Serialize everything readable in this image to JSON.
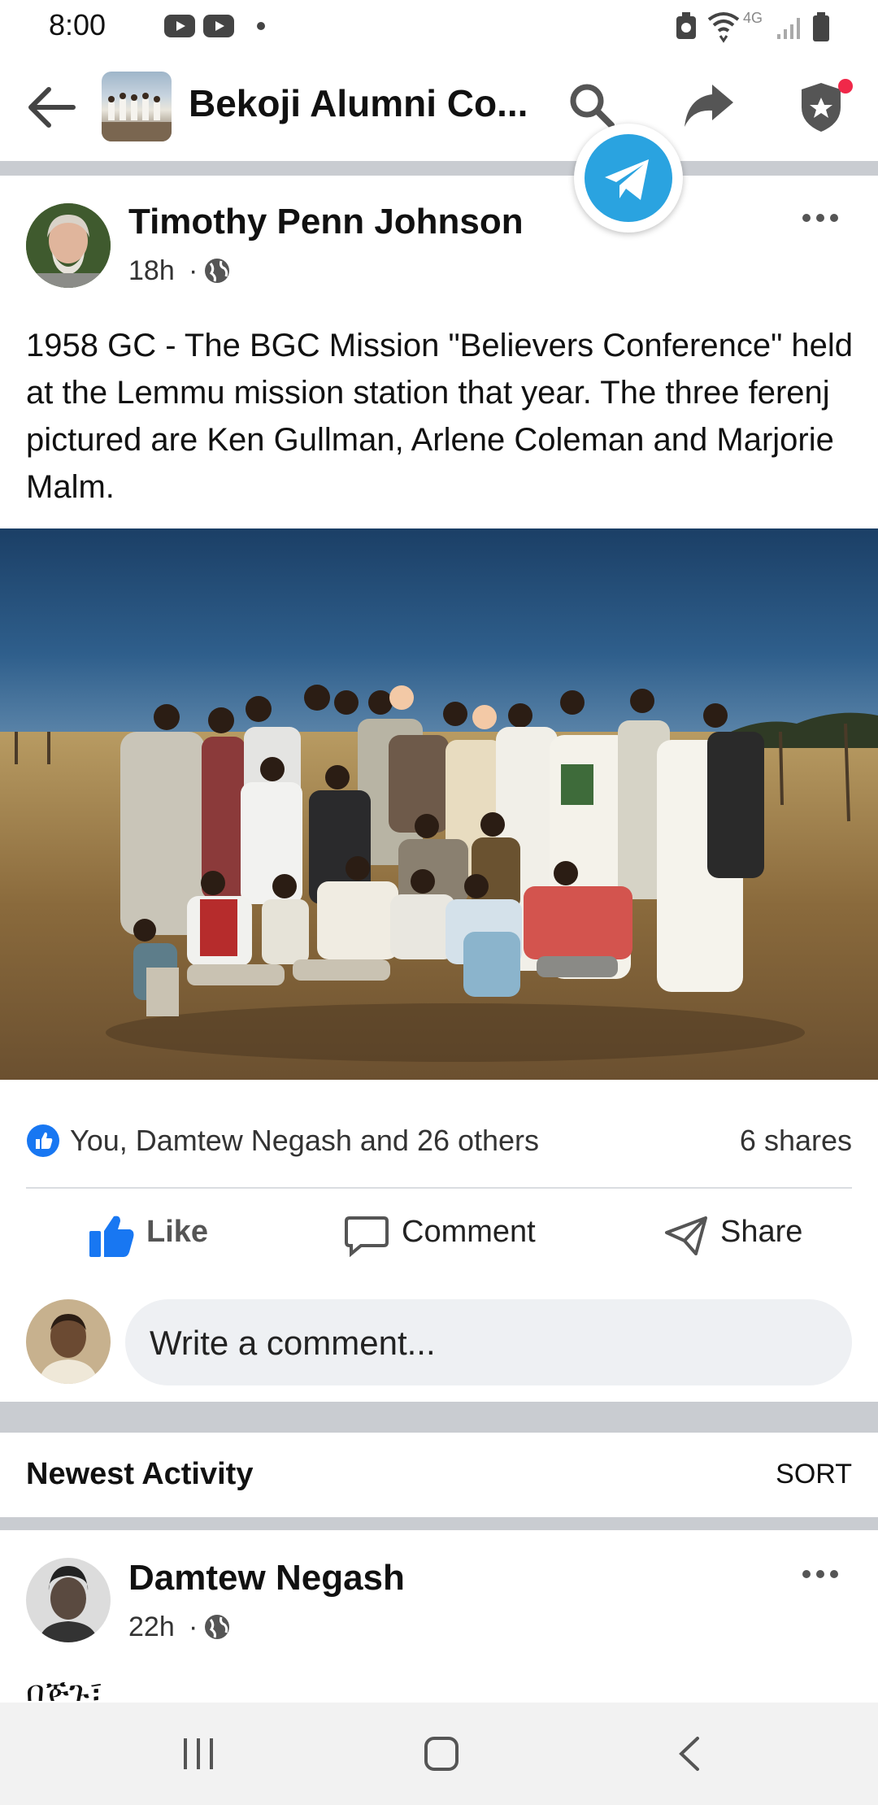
{
  "status_bar": {
    "time": "8:00",
    "network": "4G"
  },
  "header": {
    "group_title": "Bekoji Alumni Co..."
  },
  "post": {
    "author": "Timothy Penn Johnson",
    "time": "18h",
    "text": "1958 GC - The BGC Mission \"Believers Conference\" held at the Lemmu mission station that year. The three ferenj pictured are Ken Gullman, Arlene Coleman and Marjorie Malm.",
    "reactions": "You, Damtew Negash and 26 others",
    "shares": "6 shares"
  },
  "actions": {
    "like": "Like",
    "comment": "Comment",
    "share": "Share"
  },
  "comment_box": {
    "placeholder": "Write a comment..."
  },
  "activity": {
    "label": "Newest Activity",
    "sort": "SORT"
  },
  "comment": {
    "author": "Damtew Negash",
    "time": "22h",
    "text": "በጅጉ፣"
  },
  "colors": {
    "accent": "#1877f2",
    "divider": "#c9ccd1",
    "telegram": "#2aa3e0",
    "notification": "#f02849"
  }
}
